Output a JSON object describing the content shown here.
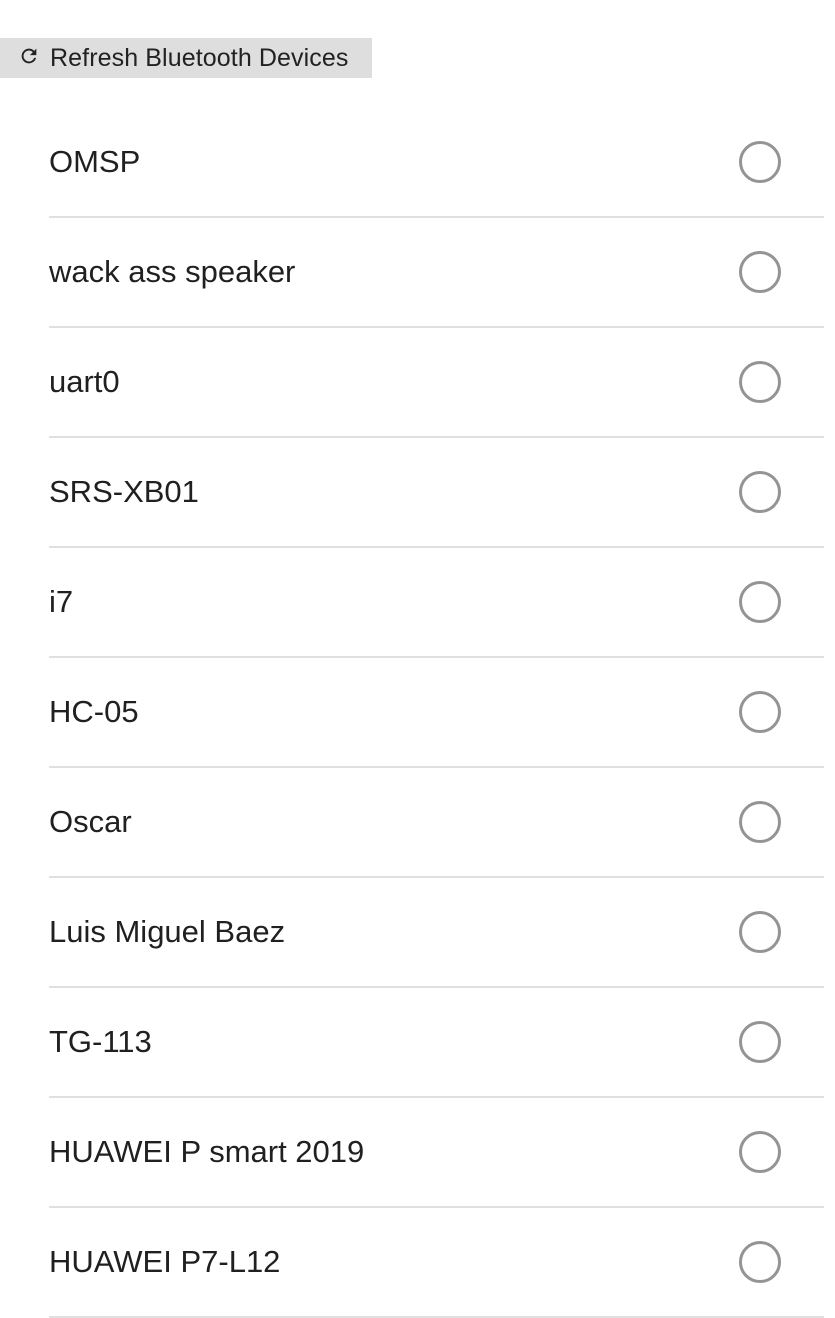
{
  "toolbar": {
    "refresh_label": "Refresh Bluetooth Devices",
    "refresh_icon": "refresh-icon"
  },
  "devices": [
    {
      "name": "OMSP",
      "selected": false
    },
    {
      "name": "wack ass speaker",
      "selected": false
    },
    {
      "name": "uart0",
      "selected": false
    },
    {
      "name": "SRS-XB01",
      "selected": false
    },
    {
      "name": "i7",
      "selected": false
    },
    {
      "name": "HC-05",
      "selected": false
    },
    {
      "name": "Oscar",
      "selected": false
    },
    {
      "name": "Luis Miguel Baez",
      "selected": false
    },
    {
      "name": "TG-113",
      "selected": false
    },
    {
      "name": "HUAWEI P smart 2019",
      "selected": false
    },
    {
      "name": "HUAWEI P7-L12",
      "selected": false
    }
  ],
  "colors": {
    "button_bg": "#dedede",
    "divider": "#e0e0e0",
    "radio_border": "#949494",
    "text": "#202020"
  }
}
